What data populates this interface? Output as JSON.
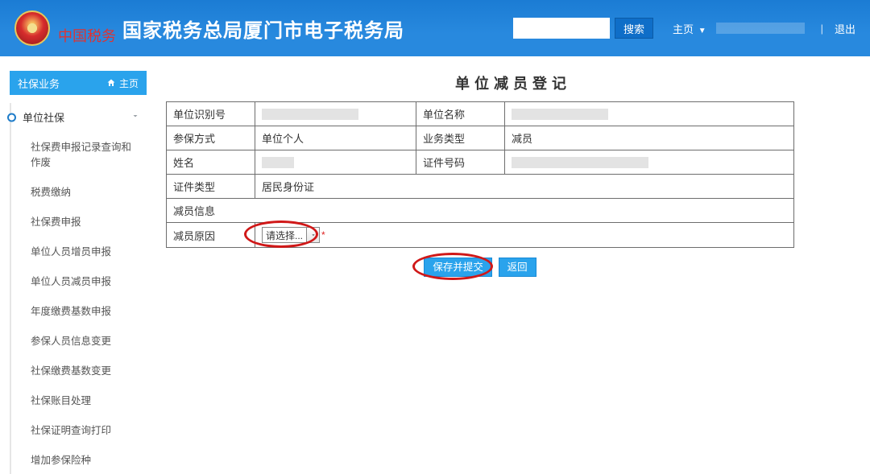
{
  "header": {
    "site_title": "国家税务总局厦门市电子税务局",
    "search_placeholder": "",
    "search_button": "搜索",
    "home_link": "主页",
    "divider": "|",
    "logout": "退出"
  },
  "sidebar": {
    "module_title": "社保业务",
    "home_label": "主页",
    "group_title": "单位社保",
    "items": [
      "社保费申报记录查询和作废",
      "税费缴纳",
      "社保费申报",
      "单位人员增员申报",
      "单位人员减员申报",
      "年度缴费基数申报",
      "参保人员信息变更",
      "社保缴费基数变更",
      "社保账目处理",
      "社保证明查询打印",
      "增加参保险种"
    ]
  },
  "main": {
    "page_title": "单位减员登记",
    "labels": {
      "unit_id": "单位识别号",
      "unit_name": "单位名称",
      "insure_mode": "参保方式",
      "biz_type": "业务类型",
      "name": "姓名",
      "cert_no": "证件号码",
      "cert_type": "证件类型",
      "reduce_info": "减员信息",
      "reduce_reason": "减员原因"
    },
    "values": {
      "insure_mode": "单位个人",
      "biz_type": "减员",
      "cert_type": "居民身份证",
      "reduce_reason_placeholder": "请选择..."
    },
    "buttons": {
      "save_submit": "保存并提交",
      "back": "返回"
    }
  }
}
